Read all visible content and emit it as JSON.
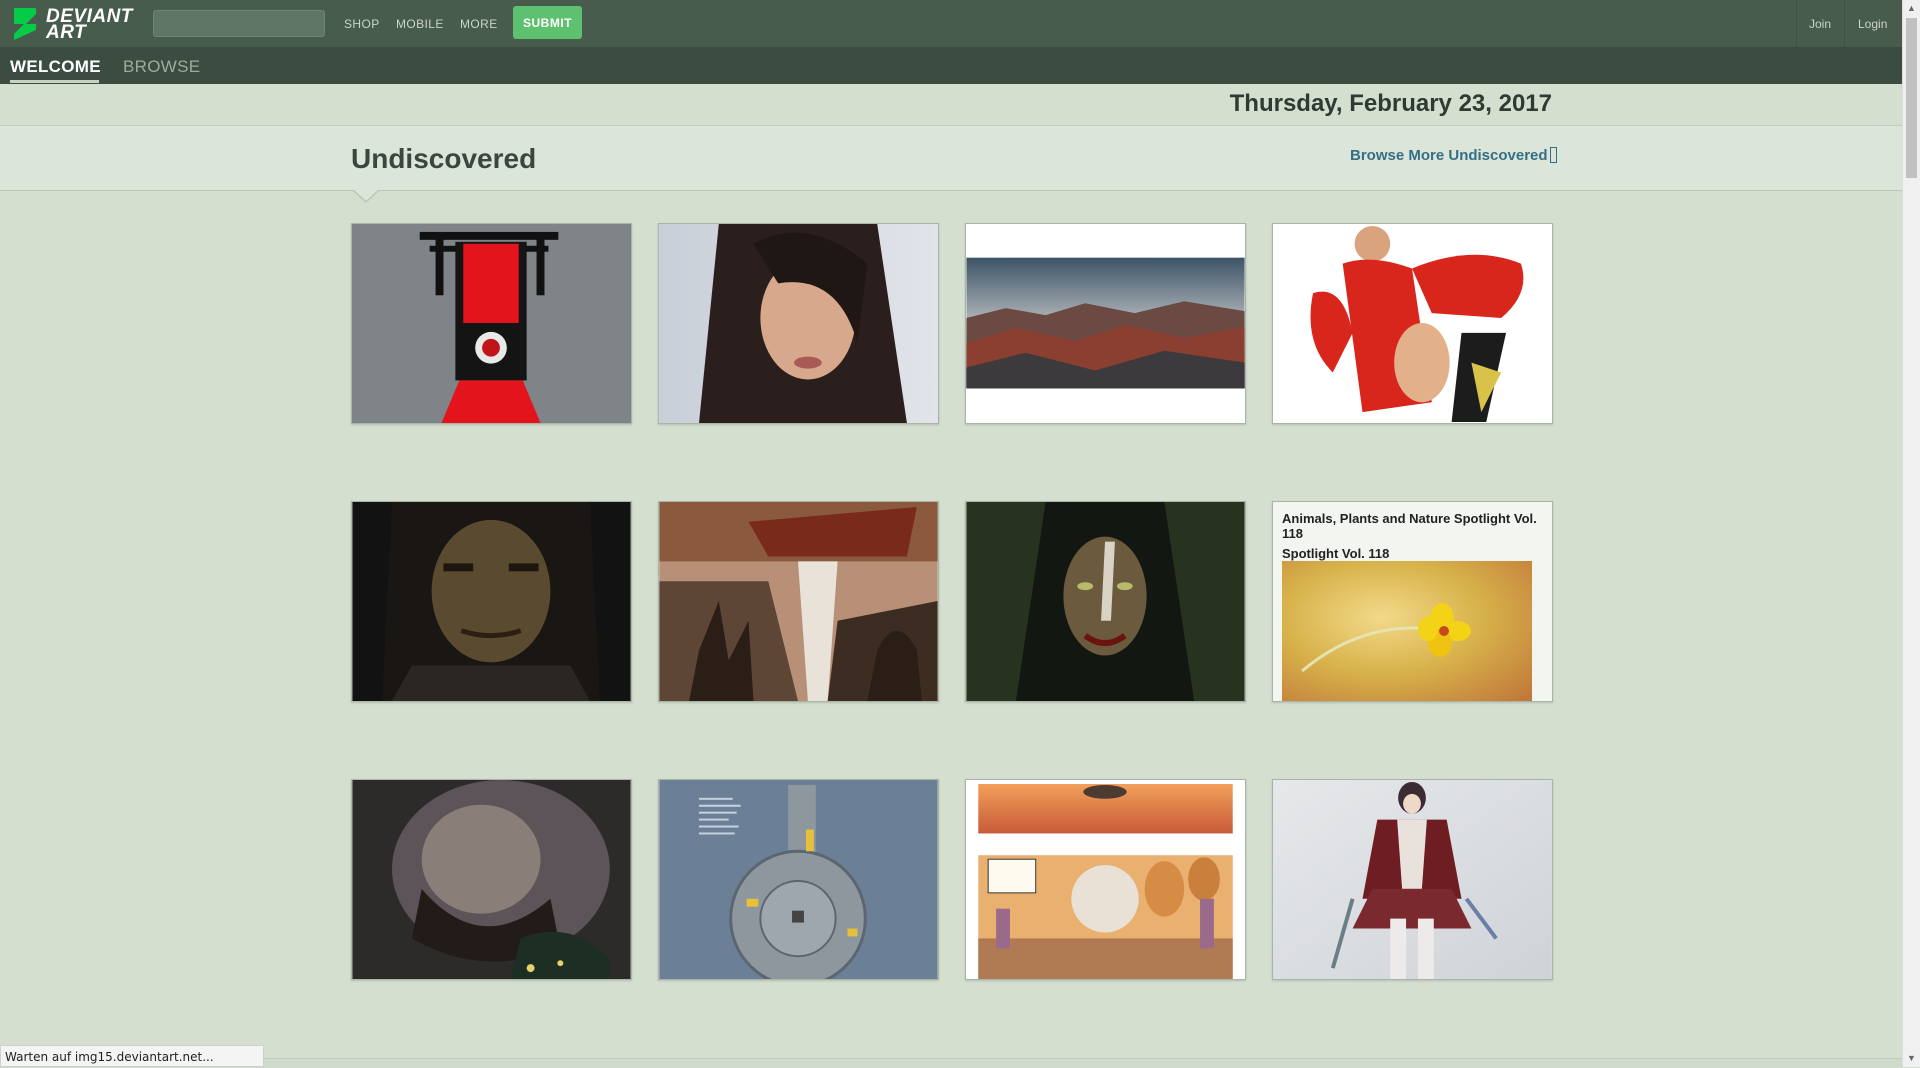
{
  "topbar": {
    "logo_text_line1": "DEVIANT",
    "logo_text_line2": "ART",
    "search_placeholder": "",
    "nav": [
      "SHOP",
      "MOBILE",
      "MORE"
    ],
    "submit_label": "SUBMIT",
    "join_label": "Join",
    "login_label": "Login",
    "bg_color": "#475c4d",
    "submit_color": "#5ec170"
  },
  "subnav": {
    "tabs": [
      {
        "label": "WELCOME",
        "active": true
      },
      {
        "label": "BROWSE",
        "active": false
      }
    ]
  },
  "date": "Thursday, February 23, 2017",
  "section": {
    "title": "Undiscovered",
    "link_label": "Browse More Undiscovered"
  },
  "spotlight": {
    "title": "Animals, Plants and Nature Spotlight Vol. 118",
    "subtitle": "Spotlight Vol. 118"
  },
  "thumbnails": [
    {
      "subject": "red-banner-torii"
    },
    {
      "subject": "woman-portrait"
    },
    {
      "subject": "mountain-landscape"
    },
    {
      "subject": "red-superhero-thumbs-up"
    },
    {
      "subject": "dark-warrior-portrait"
    },
    {
      "subject": "floating-ship-cliffs"
    },
    {
      "subject": "dark-hooded-face"
    },
    {
      "subject": "spotlight-flower"
    },
    {
      "subject": "sleeping-bearded-man"
    },
    {
      "subject": "station-map"
    },
    {
      "subject": "comic-balloon-city"
    },
    {
      "subject": "anime-character"
    }
  ],
  "status_bar": "Warten auf img15.deviantart.net..."
}
